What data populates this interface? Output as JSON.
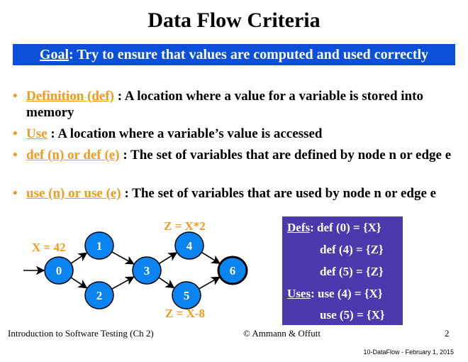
{
  "title": "Data Flow Criteria",
  "goal": {
    "label": "Goal",
    "text": ": Try to ensure that values are computed and used correctly"
  },
  "bullets": [
    {
      "term": "Definition (def)",
      "text": " : A location where a value for a variable is stored into memory"
    },
    {
      "term": "Use",
      "text": " : A location where a variable’s value is accessed"
    },
    {
      "term": "def (n) or def (e)",
      "text": " : The set of variables that are defined by node n or edge e"
    },
    {
      "term": "use (n) or use (e)",
      "text": " : The set of variables that are used by node n or edge e"
    }
  ],
  "graph": {
    "nodes": [
      "0",
      "1",
      "2",
      "3",
      "4",
      "5",
      "6"
    ],
    "annotations": {
      "node0": "X = 42",
      "node4": "Z = X*2",
      "node5": "Z = X-8"
    },
    "node_color": "#0a84f0",
    "annotation_color": "#f39a1e"
  },
  "defs_box": {
    "defs_label": "Defs",
    "uses_label": "Uses",
    "defs": [
      "def (0) = {X}",
      "def (4) = {Z}",
      "def (5) = {Z}"
    ],
    "uses": [
      "use (4) = {X}",
      "use (5) = {X}"
    ],
    "color": "#4a3aad"
  },
  "footer": {
    "left": "Introduction to Software Testing  (Ch 2)",
    "center": "© Ammann & Offutt",
    "page": "2",
    "stamp": "10-DataFlow - February 1, 2015"
  }
}
